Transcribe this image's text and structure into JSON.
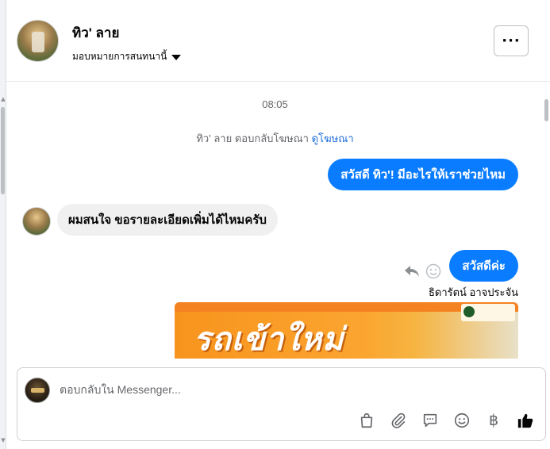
{
  "header": {
    "name": "ทิว' ลาย",
    "assign_label": "มอบหมายการสนทนานี้",
    "more_label": "···"
  },
  "thread": {
    "timestamp": "08:05",
    "system_text": "ทิว' ลาย ตอบกลับโฆษณา",
    "system_link": "ดูโฆษณา",
    "messages": [
      {
        "direction": "out",
        "text": "สวัสดี ทิว'! มีอะไรให้เราช่วยไหม"
      },
      {
        "direction": "in",
        "text": "ผมสนใจ ขอรายละเอียดเพิ่มได้ไหมครับ"
      },
      {
        "direction": "out",
        "text": "สวัสดีค่ะ"
      }
    ],
    "sender_name": "ธิดารัตน์ อาจประจัน",
    "ad_headline": "รถเข้าใหม่"
  },
  "composer": {
    "placeholder": "ตอบกลับใน Messenger...",
    "baht_symbol": "฿"
  },
  "icons": [
    "chevron-down-icon",
    "reply-icon",
    "emoji-reaction-icon",
    "shopping-bag-icon",
    "paperclip-icon",
    "saved-reply-icon",
    "emoji-icon",
    "baht-icon",
    "like-icon"
  ],
  "colors": {
    "outgoing_bubble": "#0a7cff",
    "incoming_bubble": "#f0f0f0",
    "link": "#216fdb",
    "muted_text": "#65676b"
  }
}
